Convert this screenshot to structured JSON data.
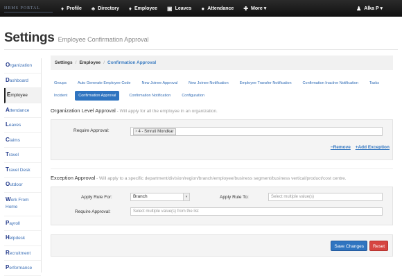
{
  "brand": {
    "logo_text": "HRMS PORTAL"
  },
  "nav": [
    {
      "icon": "person-icon",
      "glyph": "♦",
      "label": "Profile"
    },
    {
      "icon": "people-icon",
      "glyph": "♣",
      "label": "Directory"
    },
    {
      "icon": "employee-icon",
      "glyph": "♦",
      "label": "Employee"
    },
    {
      "icon": "camera-icon",
      "glyph": "▣",
      "label": "Leaves"
    },
    {
      "icon": "clock-icon",
      "glyph": "●",
      "label": "Attendance"
    },
    {
      "icon": "plus-circle-icon",
      "glyph": "✚",
      "label": "More ▾"
    }
  ],
  "user": {
    "label": "Alka P ▾"
  },
  "page": {
    "title": "Settings",
    "subtitle": "Employee Confirmation Approval"
  },
  "sidebar": [
    {
      "initial": "O",
      "rest": "rganization"
    },
    {
      "initial": "D",
      "rest": "ashboard"
    },
    {
      "initial": "E",
      "rest": "mployee",
      "active": true
    },
    {
      "initial": "A",
      "rest": "ttendance"
    },
    {
      "initial": "L",
      "rest": "eaves"
    },
    {
      "initial": "C",
      "rest": "laims"
    },
    {
      "initial": "T",
      "rest": "ravel"
    },
    {
      "initial": "T",
      "rest": "ravel Desk"
    },
    {
      "initial": "O",
      "rest": "utdoor"
    },
    {
      "initial": "W",
      "rest": "ork From Home",
      "two": true
    },
    {
      "initial": "P",
      "rest": "ayroll"
    },
    {
      "initial": "H",
      "rest": "elpdesk"
    },
    {
      "initial": "R",
      "rest": "ecruitment"
    },
    {
      "initial": "P",
      "rest": "erformance"
    }
  ],
  "breadcrumb": {
    "a": "Settings",
    "sep": "/",
    "b": "Employee",
    "c": "Confirmation Approval"
  },
  "tabs": [
    {
      "label": "Groups"
    },
    {
      "label": "Auto Generate Employee Code"
    },
    {
      "label": "New Joinee Approval"
    },
    {
      "label": "New Joinee Notification"
    },
    {
      "label": "Employee Transfer Notification"
    },
    {
      "label": "Confirmation Inactive Notification"
    },
    {
      "label": "Tasks"
    },
    {
      "label": "Incident"
    },
    {
      "label": "Confirmation Approval",
      "active": true
    },
    {
      "label": "Confirmation Notification"
    },
    {
      "label": "Configuration"
    }
  ],
  "org_section": {
    "heading": "Organization Level Approval",
    "desc": " - Will apply for all the employee in an organization.",
    "require_label": "Require Approval:",
    "tag": "4 - Smruti Mondkar",
    "remove_label": "−Remove",
    "add_exception_label": "+Add Exception"
  },
  "exception_section": {
    "heading": "Exception Approval",
    "desc": " - Will apply to a specific department/division/region/branch/employee/business segment/business vertical/product/cost centre.",
    "apply_for_label": "Apply Rule For:",
    "apply_for_value": "Branch",
    "apply_to_label": "Apply Rule To:",
    "apply_to_placeholder": "Select multiple value(s)",
    "require_label": "Require Approval:",
    "require_placeholder": "Select multiple value(s) from the list"
  },
  "footer": {
    "save_label": "Save Changes",
    "reset_label": "Reset"
  }
}
